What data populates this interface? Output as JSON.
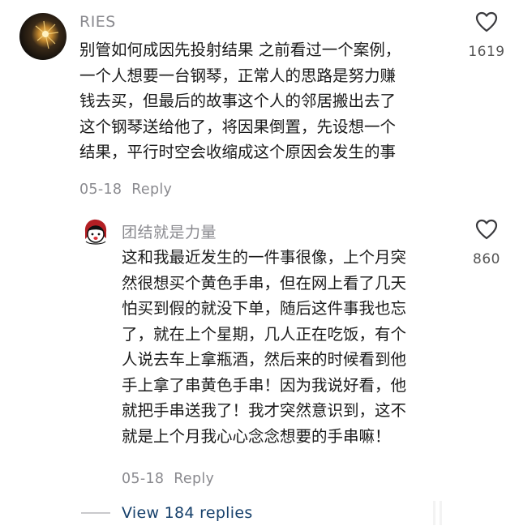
{
  "comments": [
    {
      "username": "RIES",
      "lines": [
        "别管如何成因先投射结果 之前看过一个案例，",
        "一个人想要一台钢琴，正常人的思路是努力赚",
        "钱去买，但最后的故事这个人的邻居搬出去了",
        "这个钢琴送给他了，将因果倒置，先设想一个",
        "结果，平行时空会收缩成这个原因会发生的事"
      ],
      "date": "05-18",
      "reply_label": "Reply",
      "like_count": "1619",
      "avatar_icon": "fireworks-avatar"
    },
    {
      "username": "团结就是力量",
      "lines": [
        "这和我最近发生的一件事很像，上个月突",
        "然很想买个黄色手串，但在网上看了几天",
        "怕买到假的就没下单，随后这件事我也忘",
        "了，就在上个星期，几人正在吃饭，有个",
        "人说去车上拿瓶酒，然后来的时候看到他",
        "手上拿了串黄色手串！因为我说好看，他",
        "就把手串送我了！我才突然意识到，这不",
        "就是上个月我心心念念想要的手串嘛！"
      ],
      "date": "05-18",
      "reply_label": "Reply",
      "like_count": "860",
      "avatar_icon": "cartoon-girl-avatar"
    }
  ],
  "view_replies_label": "View 184 replies",
  "icons": {
    "like": "heart-outline-icon"
  },
  "colors": {
    "username": "#8a8a8f",
    "body": "#1a1a1a",
    "link": "#16406b"
  }
}
